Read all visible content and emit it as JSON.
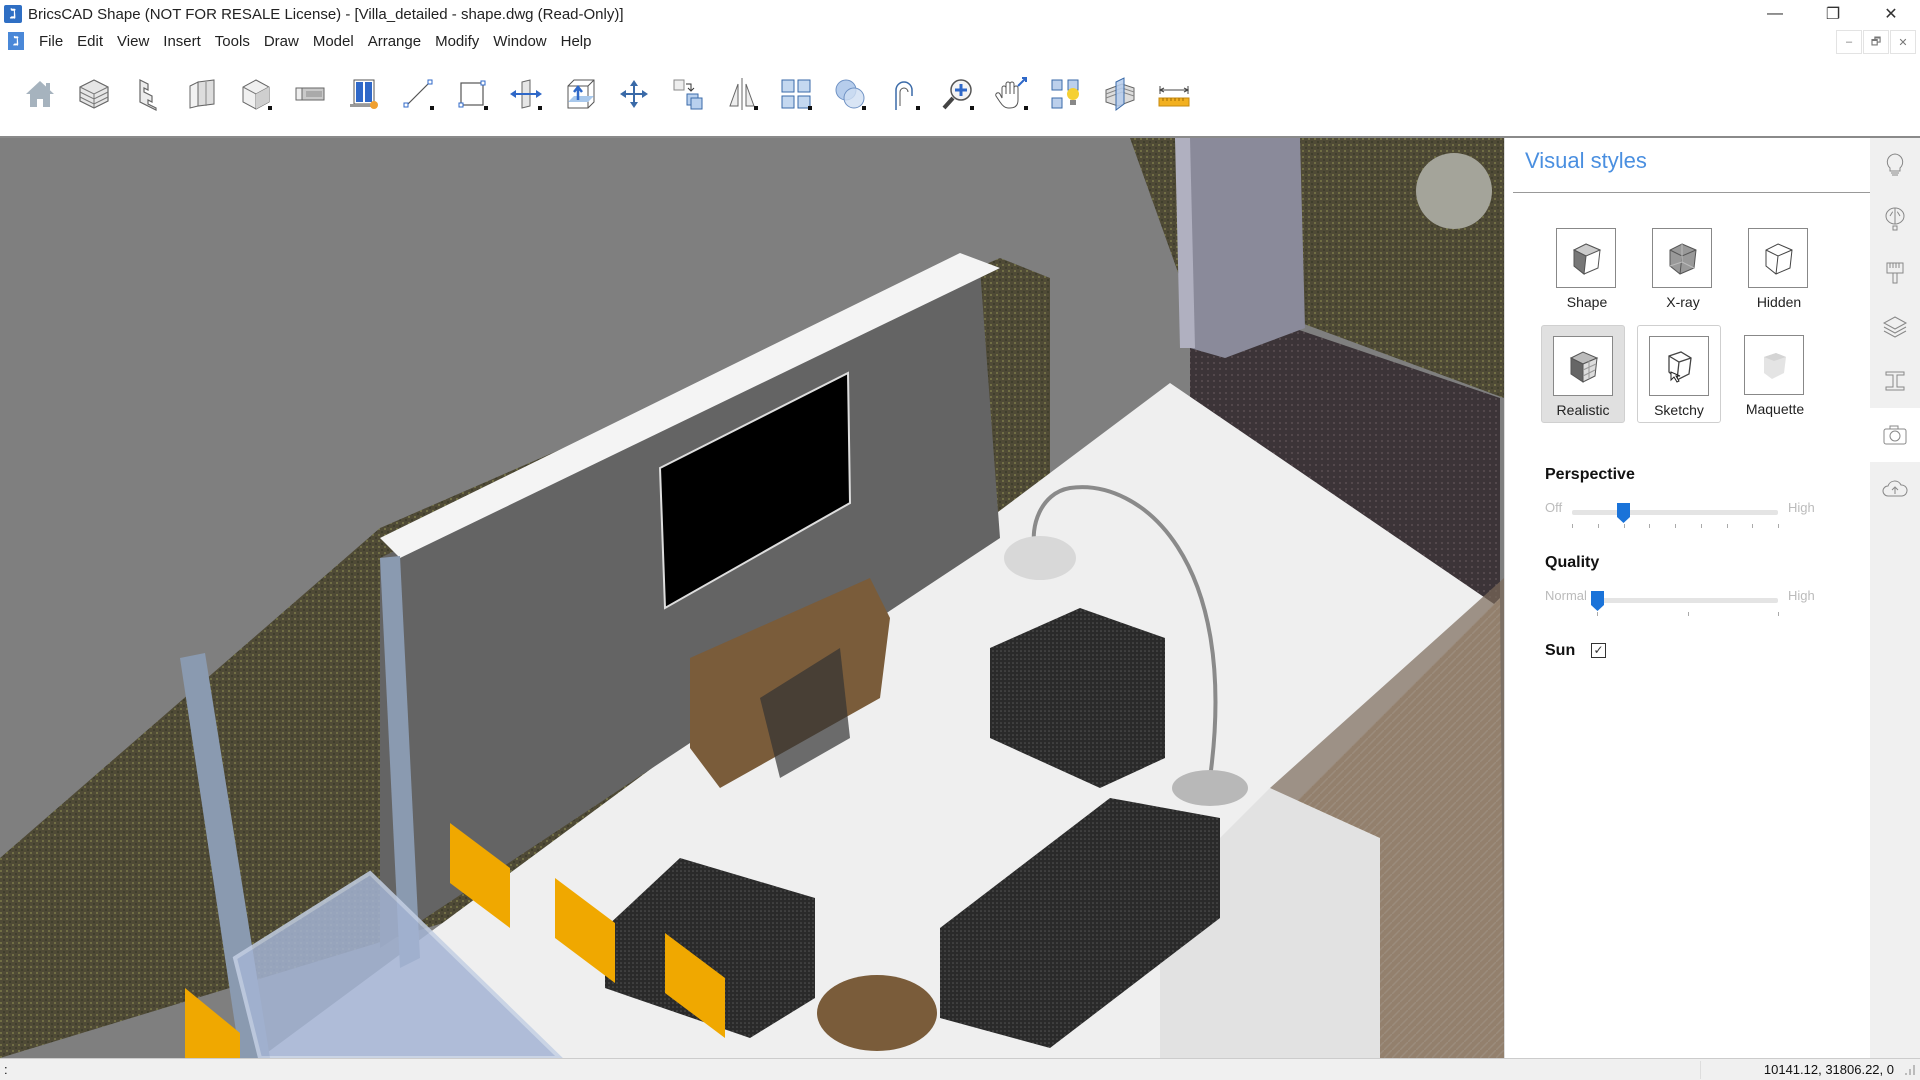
{
  "window": {
    "title": "BricsCAD Shape (NOT FOR RESALE License) - [Villa_detailed - shape.dwg (Read-Only)]",
    "app_icon": "bricscad-logo-icon",
    "controls": {
      "minimize": "—",
      "restore": "❐",
      "close": "✕"
    },
    "mdi_controls": {
      "minimize": "–",
      "restore": "🗗",
      "close": "✕"
    }
  },
  "menu": {
    "items": [
      "File",
      "Edit",
      "View",
      "Insert",
      "Tools",
      "Draw",
      "Model",
      "Arrange",
      "Modify",
      "Window",
      "Help"
    ]
  },
  "toolbar": {
    "tools": [
      {
        "name": "home-icon",
        "tooltip": "Home"
      },
      {
        "name": "brick-block-icon",
        "tooltip": "Solid"
      },
      {
        "name": "stairs-icon",
        "tooltip": "Stairs"
      },
      {
        "name": "wall-icon",
        "tooltip": "Wall"
      },
      {
        "name": "box-icon",
        "tooltip": "Box"
      },
      {
        "name": "slab-icon",
        "tooltip": "Slab"
      },
      {
        "name": "window-icon",
        "tooltip": "Window"
      },
      {
        "name": "line-icon",
        "tooltip": "Line"
      },
      {
        "name": "rectangle-icon",
        "tooltip": "Rectangle"
      },
      {
        "name": "push-pull-icon",
        "tooltip": "Push/Pull"
      },
      {
        "name": "extrude-icon",
        "tooltip": "Extrude"
      },
      {
        "name": "move-icon",
        "tooltip": "Move"
      },
      {
        "name": "copy-icon",
        "tooltip": "Copy"
      },
      {
        "name": "mirror-icon",
        "tooltip": "Mirror"
      },
      {
        "name": "array-icon",
        "tooltip": "Array"
      },
      {
        "name": "union-icon",
        "tooltip": "Boolean"
      },
      {
        "name": "fillet-icon",
        "tooltip": "Fillet"
      },
      {
        "name": "zoom-icon",
        "tooltip": "Zoom"
      },
      {
        "name": "pan-icon",
        "tooltip": "Pan"
      },
      {
        "name": "layout-light-icon",
        "tooltip": "Lights"
      },
      {
        "name": "section-icon",
        "tooltip": "Section"
      },
      {
        "name": "measure-icon",
        "tooltip": "Measure"
      }
    ]
  },
  "panel": {
    "title": "Visual styles",
    "styles": [
      {
        "label": "Shape",
        "icon": "shape-cube-icon",
        "state": "normal"
      },
      {
        "label": "X-ray",
        "icon": "xray-cube-icon",
        "state": "normal"
      },
      {
        "label": "Hidden",
        "icon": "hidden-cube-icon",
        "state": "normal"
      },
      {
        "label": "Realistic",
        "icon": "realistic-cube-icon",
        "state": "selected"
      },
      {
        "label": "Sketchy",
        "icon": "sketchy-cube-icon",
        "state": "hover"
      },
      {
        "label": "Maquette",
        "icon": "maquette-cube-icon",
        "state": "normal"
      }
    ],
    "perspective": {
      "label": "Perspective",
      "min_label": "Off",
      "max_label": "High",
      "value": 0.25,
      "ticks": 9
    },
    "quality": {
      "label": "Quality",
      "min_label": "Normal",
      "max_label": "High",
      "value": 0,
      "ticks": 3
    },
    "sun": {
      "label": "Sun",
      "checked": true,
      "check_glyph": "✓"
    },
    "accent": "#1a73d9"
  },
  "rail": {
    "items": [
      {
        "name": "lightbulb-icon",
        "active": false
      },
      {
        "name": "balloon-icon",
        "active": false
      },
      {
        "name": "paint-brush-icon",
        "active": false
      },
      {
        "name": "layers-icon",
        "active": false
      },
      {
        "name": "i-beam-icon",
        "active": false
      },
      {
        "name": "camera-icon",
        "active": true
      },
      {
        "name": "cloud-upload-icon",
        "active": false
      }
    ]
  },
  "status": {
    "prompt": ":",
    "coordinates": "10141.12, 31806.22, 0"
  }
}
